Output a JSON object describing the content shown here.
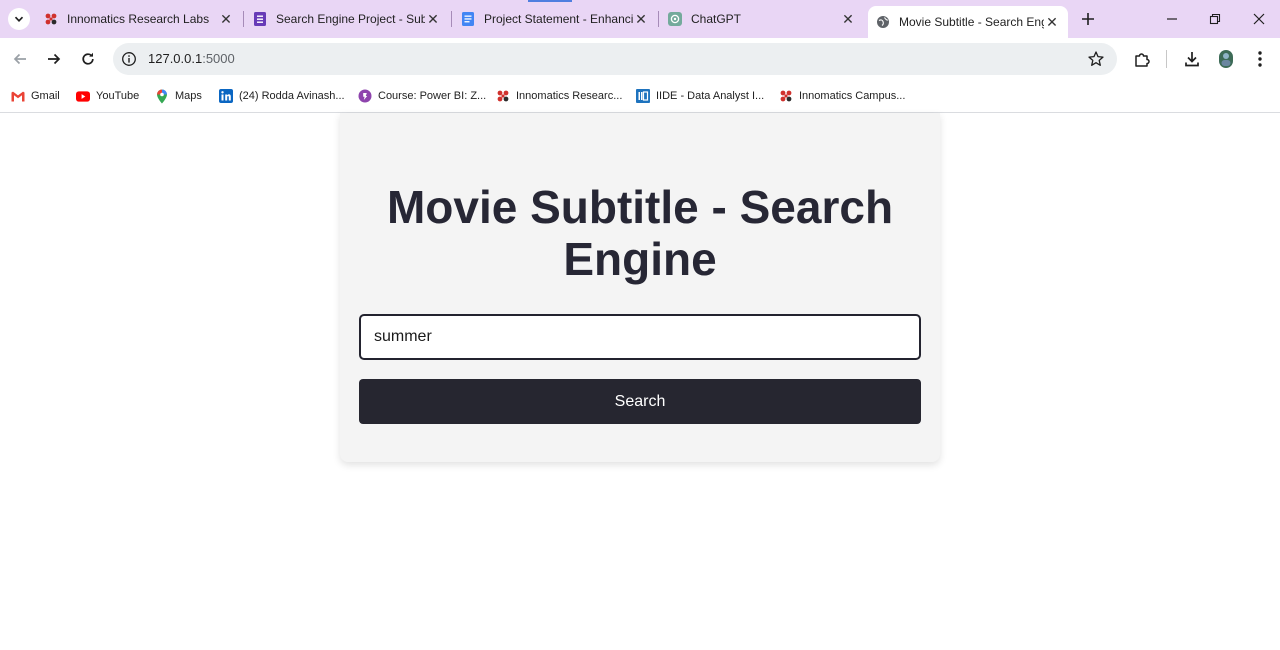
{
  "browser": {
    "tabs": [
      {
        "title": "Innomatics Research Labs",
        "icon": "innomatics-logo-icon",
        "active": false
      },
      {
        "title": "Search Engine Project - Subm",
        "icon": "google-forms-icon",
        "active": false
      },
      {
        "title": "Project Statement - Enhancin",
        "icon": "google-docs-icon",
        "active": false
      },
      {
        "title": "ChatGPT",
        "icon": "chatgpt-icon",
        "active": false
      },
      {
        "title": "Movie Subtitle - Search Engi",
        "icon": "globe-icon",
        "active": true
      }
    ],
    "address": {
      "host": "127.0.0.1",
      "port": ":5000"
    },
    "bookmarks": [
      {
        "label": "Gmail",
        "icon": "gmail-icon"
      },
      {
        "label": "YouTube",
        "icon": "youtube-icon"
      },
      {
        "label": "Maps",
        "icon": "maps-icon"
      },
      {
        "label": "(24) Rodda Avinash...",
        "icon": "linkedin-icon"
      },
      {
        "label": "Course: Power BI: Z...",
        "icon": "course-icon"
      },
      {
        "label": "Innomatics Researc...",
        "icon": "innomatics-logo-icon"
      },
      {
        "label": "IIDE - Data Analyst I...",
        "icon": "iide-icon"
      },
      {
        "label": "Innomatics Campus...",
        "icon": "innomatics-logo-icon"
      }
    ]
  },
  "page": {
    "heading": "Movie Subtitle - Search Engine",
    "search": {
      "value": "summer"
    },
    "button_label": "Search"
  },
  "colors": {
    "tabstrip": "#e9d6f5",
    "card_bg": "#f4f4f4",
    "heading": "#272735",
    "button_bg": "#262630",
    "button_text": "#ffffff"
  }
}
